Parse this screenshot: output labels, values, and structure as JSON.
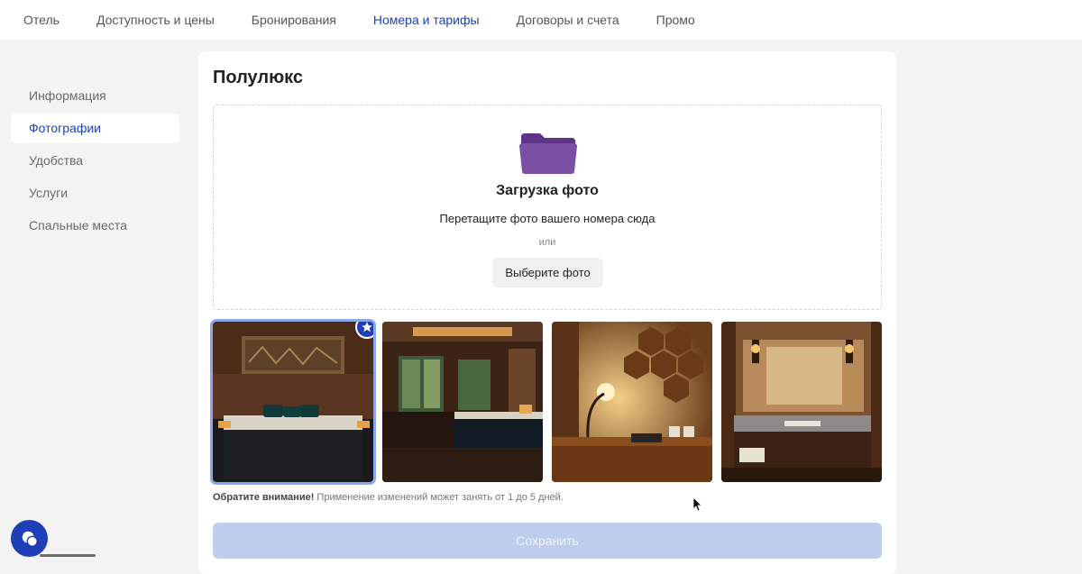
{
  "topnav": {
    "items": [
      {
        "label": "Отель"
      },
      {
        "label": "Доступность и цены"
      },
      {
        "label": "Бронирования"
      },
      {
        "label": "Номера и тарифы"
      },
      {
        "label": "Договоры и счета"
      },
      {
        "label": "Промо"
      }
    ],
    "active_index": 3
  },
  "sidebar": {
    "items": [
      {
        "label": "Информация"
      },
      {
        "label": "Фотографии"
      },
      {
        "label": "Удобства"
      },
      {
        "label": "Услуги"
      },
      {
        "label": "Спальные места"
      }
    ],
    "active_index": 1
  },
  "room": {
    "title": "Полулюкс"
  },
  "upload": {
    "icon": "folder-icon",
    "title": "Загрузка фото",
    "hint": "Перетащите фото вашего номера сюда",
    "or": "или",
    "button_label": "Выберите фото"
  },
  "photos": {
    "items": [
      {
        "alt": "bedroom-with-tapestry",
        "main": true
      },
      {
        "alt": "bedroom-with-balcony",
        "main": false
      },
      {
        "alt": "desk-with-lamp",
        "main": false
      },
      {
        "alt": "bathroom-vanity",
        "main": false
      }
    ],
    "main_icon": "star-icon"
  },
  "note": {
    "bold": "Обратите внимание!",
    "text": " Применение изменений может занять от 1 до 5 дней."
  },
  "save_label": "Сохранить",
  "colors": {
    "accent": "#1f3fb8",
    "folder": "#7b4fa3",
    "save_disabled": "#bfcdec"
  }
}
